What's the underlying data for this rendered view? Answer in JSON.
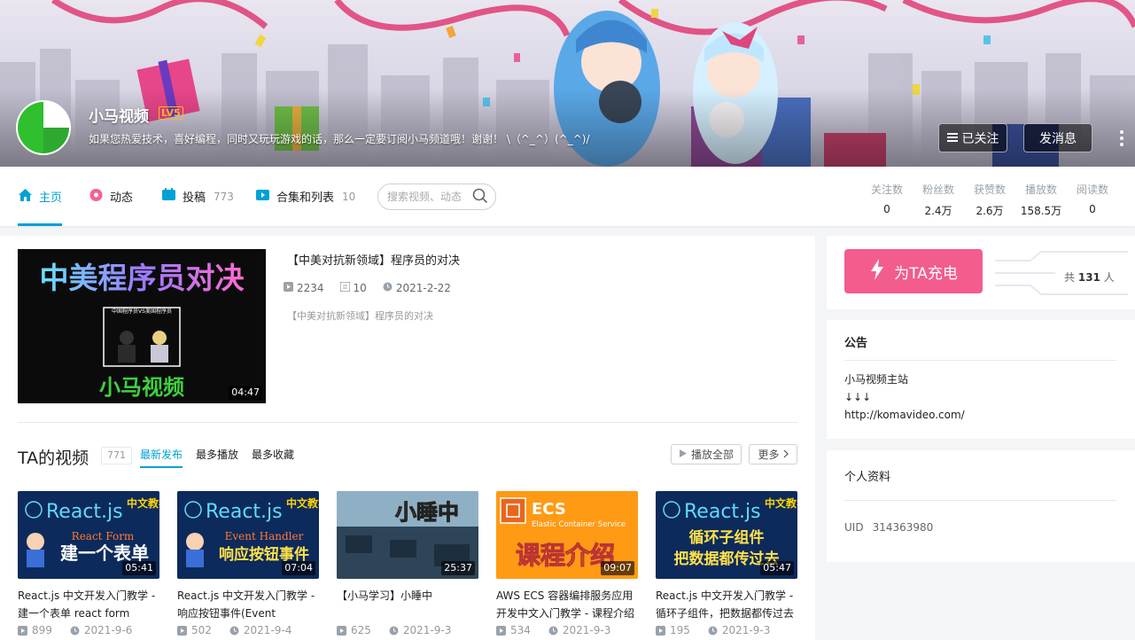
{
  "profile": {
    "name": "小马视频",
    "level": "LV5",
    "sign": "如果您热爱技术，喜好编程，同时又玩玩游戏的话，那么一定要订阅小马频道哦！谢谢！  \\（^_^）(^_^)/",
    "follow_label": "已关注",
    "message_label": "发消息"
  },
  "nav": {
    "items": [
      {
        "label": "主页",
        "count": ""
      },
      {
        "label": "动态",
        "count": ""
      },
      {
        "label": "投稿",
        "count": "773"
      },
      {
        "label": "合集和列表",
        "count": "10"
      }
    ],
    "search_placeholder": "搜索视频、动态"
  },
  "stats": [
    {
      "label": "关注数",
      "value": "0"
    },
    {
      "label": "粉丝数",
      "value": "2.4万"
    },
    {
      "label": "获赞数",
      "value": "2.6万"
    },
    {
      "label": "播放数",
      "value": "158.5万"
    },
    {
      "label": "阅读数",
      "value": "0"
    }
  ],
  "featured": {
    "thumb_title": "中美程序员对决",
    "thumb_small": "中国程序员VS美国程序员",
    "thumb_brand": "小马视频",
    "duration": "04:47",
    "title": "【中美对抗新领域】程序员的对决",
    "plays": "2234",
    "danmaku": "10",
    "date": "2021-2-22",
    "desc": "【中美对抗新领域】程序员的对决"
  },
  "videos_section": {
    "title": "TA的视频",
    "count": "771",
    "tabs": [
      "最新发布",
      "最多播放",
      "最多收藏"
    ],
    "play_all": "播放全部",
    "more": "更多"
  },
  "videos": [
    {
      "thumb_line1": "React.js",
      "thumb_tag": "中文教学",
      "thumb_line2": "React Form",
      "thumb_line3": "建一个表单",
      "duration": "05:41",
      "title": "React.js 中文开发入门教学 - 建一个表单 react form",
      "plays": "899",
      "date": "2021-9-6"
    },
    {
      "thumb_line1": "React.js",
      "thumb_tag": "中文教学",
      "thumb_line2": "Event Handler",
      "thumb_line3": "响应按钮事件",
      "duration": "07:04",
      "title": "React.js 中文开发入门教学 - 响应按钮事件(Event",
      "plays": "502",
      "date": "2021-9-4"
    },
    {
      "thumb_line1": "小睡中",
      "duration": "25:37",
      "title": "【小马学习】小睡中",
      "plays": "625",
      "date": "2021-9-3"
    },
    {
      "thumb_line1": "ECS",
      "thumb_line2": "Elastic Container Service",
      "thumb_line3": "课程介绍",
      "duration": "09:07",
      "title": "AWS ECS 容器编排服务应用开发中文入门教学 - 课程介绍",
      "plays": "534",
      "date": "2021-9-3"
    },
    {
      "thumb_line1": "React.js",
      "thumb_tag": "中文教学",
      "thumb_line2": "循环子组件",
      "thumb_line3": "把数据都传过去",
      "duration": "05:47",
      "title": "React.js 中文开发入门教学 - 循环子组件，把数据都传过去",
      "plays": "195",
      "date": "2021-9-3"
    }
  ],
  "charge": {
    "label": "为TA充电",
    "count_prefix": "共",
    "count": "131",
    "count_suffix": "人"
  },
  "notice": {
    "title": "公告",
    "line1": "小马视频主站",
    "line2": "↓↓↓",
    "line3": "http://komavideo.com/"
  },
  "info": {
    "title": "个人资料",
    "uid_label": "UID",
    "uid": "314363980"
  },
  "colors": {
    "accent": "#00a1d6",
    "charge": "#f25d8e",
    "react_bg": "#0d2a5c"
  }
}
